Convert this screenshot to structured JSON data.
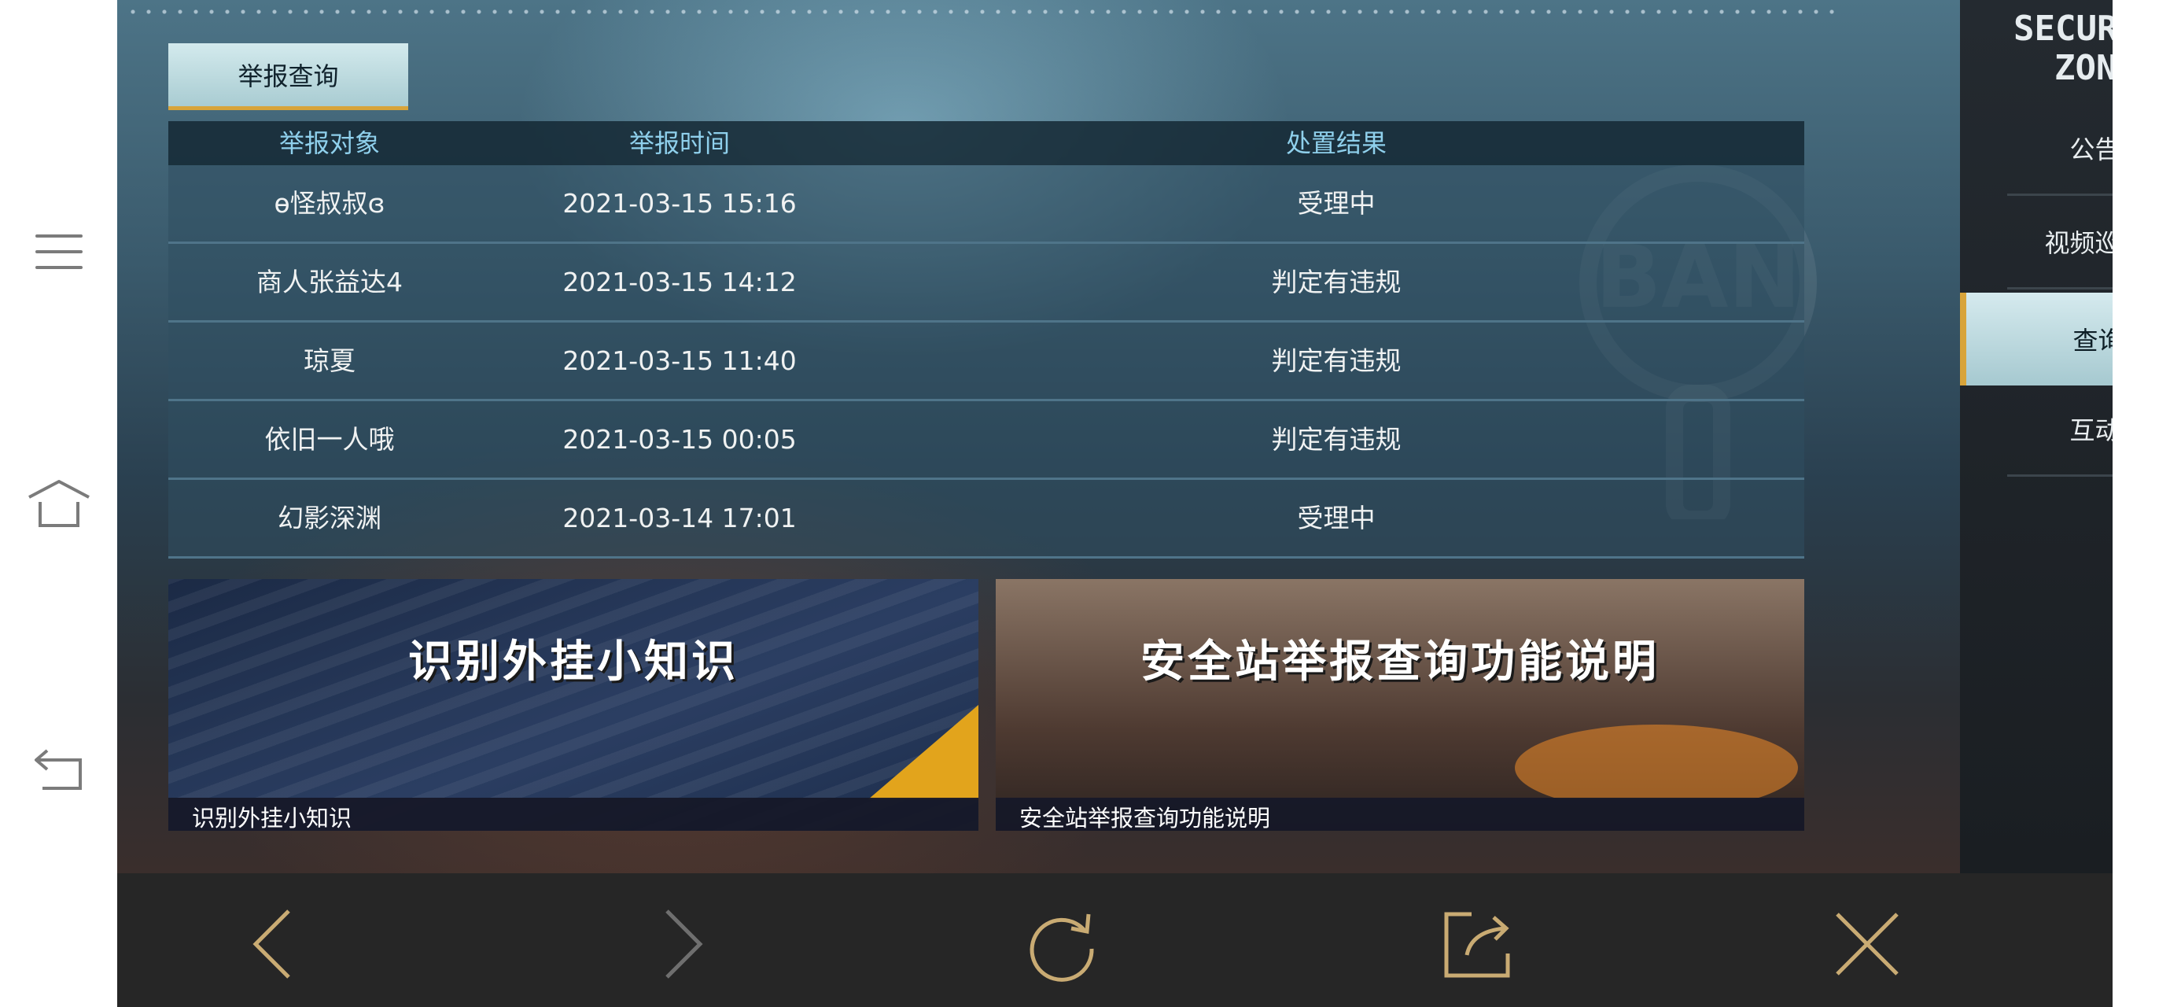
{
  "system_bar": {
    "icons": [
      "menu-icon",
      "home-icon",
      "back-icon"
    ]
  },
  "tabs": {
    "query_label": "举报查询"
  },
  "table": {
    "headers": [
      "举报对象",
      "举报时间",
      "处置结果"
    ],
    "rows": [
      [
        "ɵ怪叔叔ɞ",
        "2021-03-15 15:16",
        "受理中"
      ],
      [
        "商人张益达4",
        "2021-03-15 14:12",
        "判定有违规"
      ],
      [
        "琼夏",
        "2021-03-15 11:40",
        "判定有违规"
      ],
      [
        "依旧一人哦",
        "2021-03-15 00:05",
        "判定有违规"
      ],
      [
        "幻影深渊",
        "2021-03-14 17:01",
        "受理中"
      ]
    ]
  },
  "banners": [
    {
      "headline": "识别外挂小知识",
      "caption": "识别外挂小知识"
    },
    {
      "headline": "安全站举报查询功能说明",
      "caption": "安全站举报查询功能说明"
    }
  ],
  "sidebar": {
    "logo_line1": "SECURITY",
    "logo_line2": "ZONE",
    "items": [
      "公告",
      "视频巡查",
      "查询",
      "互动"
    ],
    "active_index": 2
  },
  "toolbar": {
    "icons": [
      "back-arrow-icon",
      "forward-arrow-icon",
      "refresh-icon",
      "share-icon",
      "close-icon"
    ]
  },
  "colors": {
    "accent_gold": "#d8a43a",
    "header_text": "#8fd0ec",
    "toolbar_icon": "#c9ab73"
  }
}
